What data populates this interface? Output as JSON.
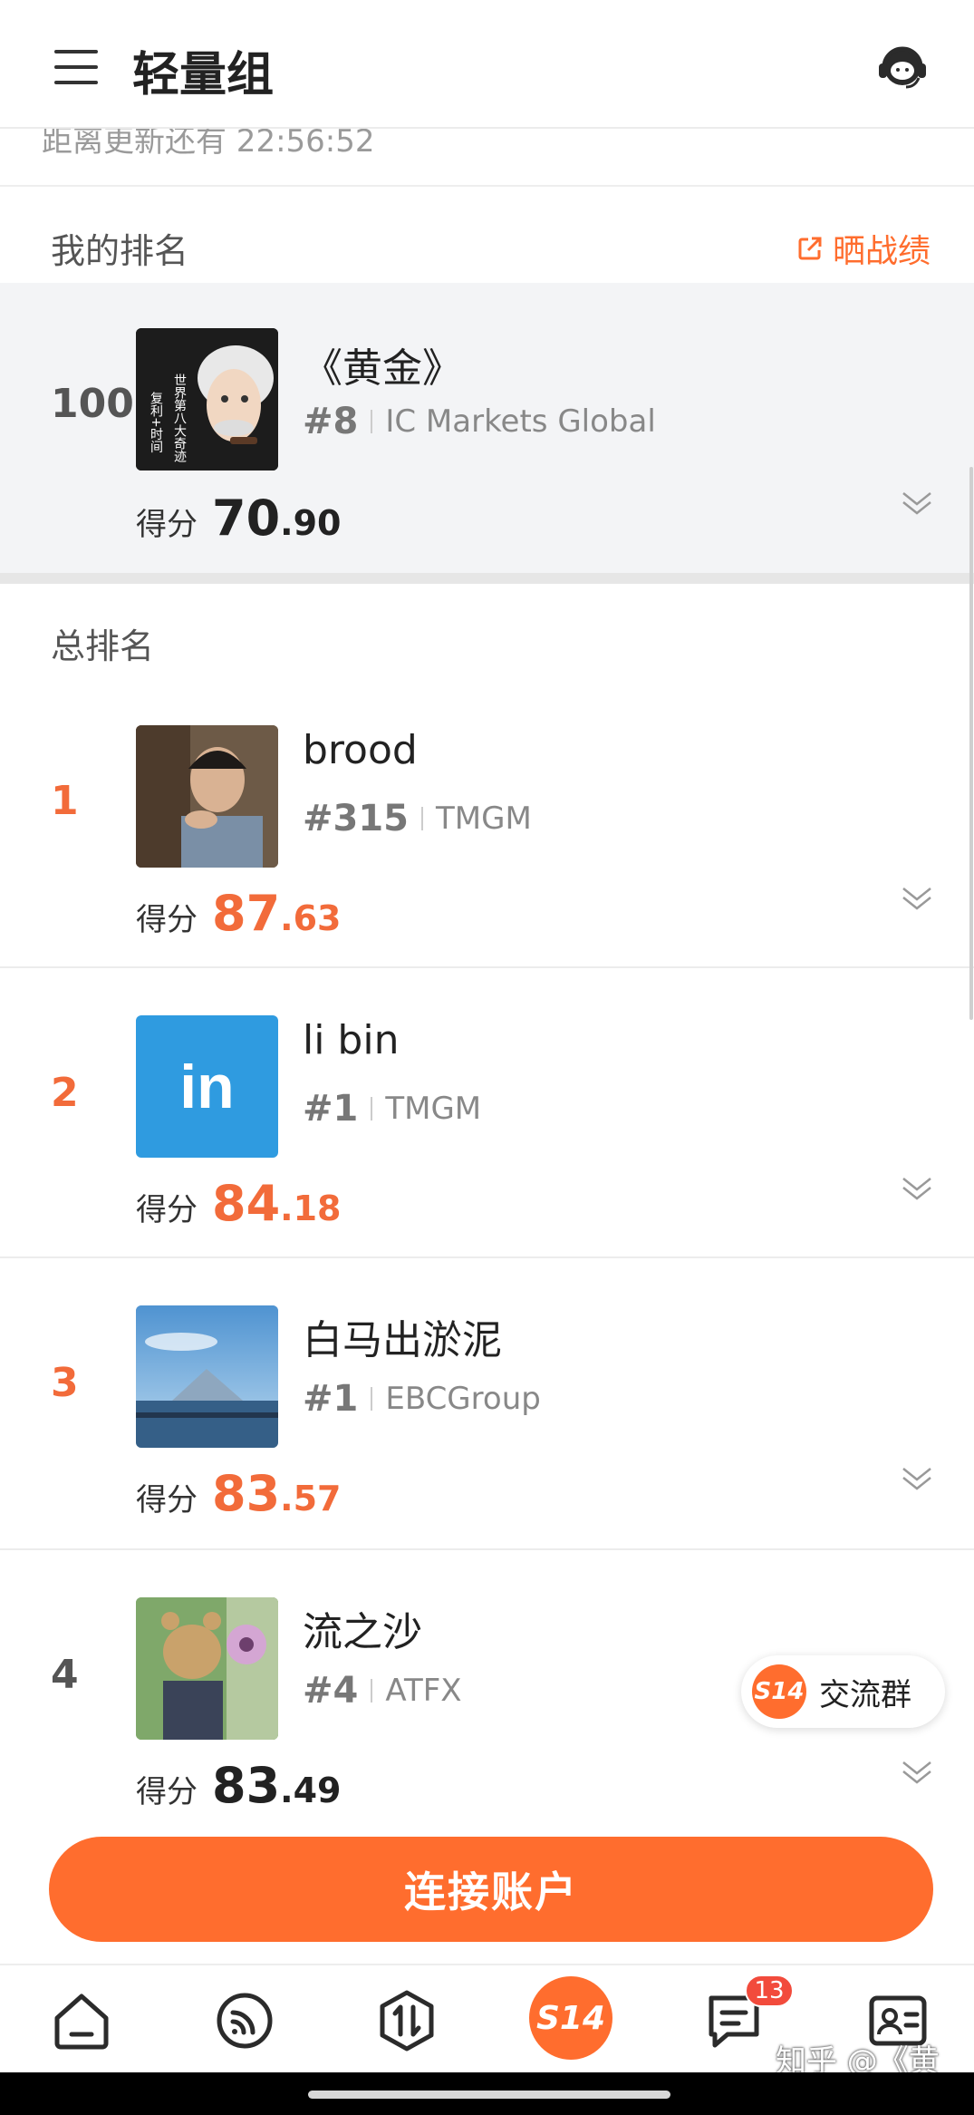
{
  "header": {
    "title": "轻量组",
    "menu_icon": "hamburger-menu-icon",
    "support_icon": "customer-service-headset-icon"
  },
  "countdown": {
    "text": "距离更新还有 22:56:52"
  },
  "my_rank_section": {
    "label": "我的排名",
    "share_label": "晒战绩",
    "share_icon": "external-share-icon"
  },
  "my_rank": {
    "rank": "100",
    "name": "《黄金》",
    "hash": "#8",
    "broker": "IC Markets Global",
    "score_label": "得分",
    "score_int": "70",
    "score_dec": ".90",
    "avatar_text": "复利+时间 世界第八大奇迹"
  },
  "overall_section": {
    "label": "总排名"
  },
  "rankings": [
    {
      "rank": "1",
      "name": "brood",
      "hash": "#315",
      "broker": "TMGM",
      "score_label": "得分",
      "score_int": "87",
      "score_dec": ".63"
    },
    {
      "rank": "2",
      "name": "li bin",
      "hash": "#1",
      "broker": "TMGM",
      "score_label": "得分",
      "score_int": "84",
      "score_dec": ".18",
      "avatar_text": "in"
    },
    {
      "rank": "3",
      "name": "白马出淤泥",
      "hash": "#1",
      "broker": "EBCGroup",
      "score_label": "得分",
      "score_int": "83",
      "score_dec": ".57"
    },
    {
      "rank": "4",
      "name": "流之沙",
      "hash": "#4",
      "broker": "ATFX",
      "score_label": "得分",
      "score_int": "83",
      "score_dec": ".49"
    }
  ],
  "chat_pill": {
    "badge": "S14",
    "label": "交流群"
  },
  "connect_button": {
    "label": "连接账户"
  },
  "tabbar": {
    "items": [
      {
        "icon": "home-icon"
      },
      {
        "icon": "feed-broadcast-icon"
      },
      {
        "icon": "trade-arrows-icon"
      },
      {
        "icon": "s14-center-icon",
        "label": "S14"
      },
      {
        "icon": "message-icon",
        "badge": "13"
      },
      {
        "icon": "profile-card-icon"
      }
    ]
  },
  "watermark": "知乎 @《黄金》",
  "colors": {
    "accent": "#ff6d2e",
    "rank_top": "#f26b3a",
    "badge_red": "#f24b3c",
    "card_bg": "#f3f4f6"
  }
}
